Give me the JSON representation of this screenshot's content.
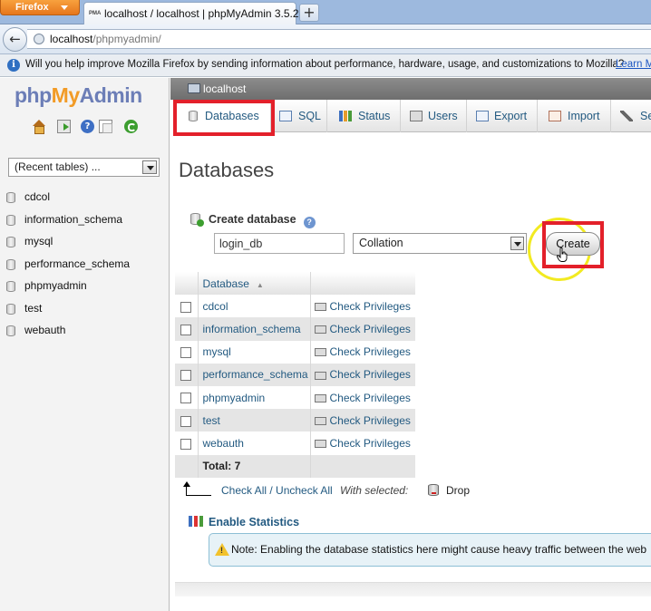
{
  "browser": {
    "menu_button": "Firefox",
    "tab_favicon": "PMA",
    "tab_title": "localhost / localhost | phpMyAdmin 3.5.2",
    "new_tab_label": "+",
    "url_host": "localhost",
    "url_path": "/phpmyadmin/",
    "notification": "Will you help improve Mozilla Firefox by sending information about performance, hardware, usage, and customizations to Mozilla?",
    "notification_link": "Learn M"
  },
  "sidebar": {
    "logo_php": "php",
    "logo_my": "My",
    "logo_admin": "Admin",
    "recent_tables": "(Recent tables) ...",
    "databases": [
      "cdcol",
      "information_schema",
      "mysql",
      "performance_schema",
      "phpmyadmin",
      "test",
      "webauth"
    ]
  },
  "server": {
    "breadcrumb": "localhost"
  },
  "menu": {
    "databases": "Databases",
    "sql": "SQL",
    "status": "Status",
    "users": "Users",
    "export": "Export",
    "import": "Import",
    "settings": "Se"
  },
  "main": {
    "title": "Databases",
    "create_label": "Create database",
    "help_icon": "?",
    "db_name_value": "login_db",
    "collation_placeholder": "Collation",
    "create_button": "Create",
    "table": {
      "header_name": "Database",
      "sort_indicator": "▲",
      "privileges_link": "Check Privileges",
      "rows": [
        "cdcol",
        "information_schema",
        "mysql",
        "performance_schema",
        "phpmyadmin",
        "test",
        "webauth"
      ],
      "total": "Total: 7"
    },
    "check_all": "Check All / Uncheck All",
    "with_selected": "With selected:",
    "drop": "Drop",
    "enable_statistics": "Enable Statistics",
    "notice": "Note: Enabling the database statistics here might cause heavy traffic between the web"
  },
  "colors": {
    "link": "#235a81",
    "logo_blue": "#6c7eb7",
    "logo_orange": "#f29b26",
    "annotation_red": "#e3202a",
    "annotation_yellow": "#f2ea21"
  }
}
